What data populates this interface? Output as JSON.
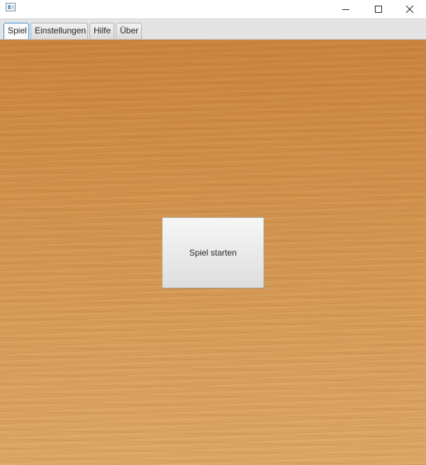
{
  "window": {
    "icon": "java-app-icon",
    "controls": {
      "minimize_icon": "minimize-icon",
      "maximize_icon": "maximize-icon",
      "close_icon": "close-icon"
    }
  },
  "tabs": [
    {
      "label": "Spiel",
      "active": true
    },
    {
      "label": "Einstellungen",
      "active": false
    },
    {
      "label": "Hilfe",
      "active": false
    },
    {
      "label": "Über",
      "active": false
    }
  ],
  "main": {
    "background": "wood-texture",
    "start_button_label": "Spiel starten"
  },
  "colors": {
    "accent_tab_border": "#3c8fd6",
    "wood_base": "#d59a55"
  }
}
